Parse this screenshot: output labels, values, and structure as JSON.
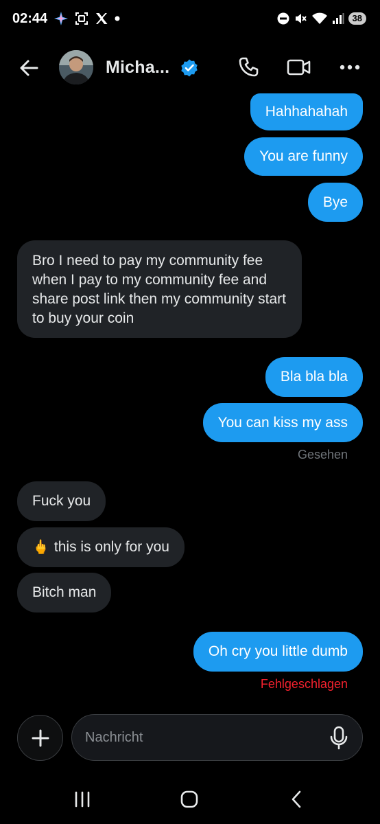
{
  "status_bar": {
    "time": "02:44",
    "battery": "38",
    "left_icons": [
      "sparkle-icon",
      "screenshot-icon",
      "x-logo-icon",
      "dot-icon"
    ],
    "right_icons": [
      "dnd-icon",
      "mute-icon",
      "wifi-icon",
      "signal-icon",
      "battery-icon"
    ]
  },
  "header": {
    "contact_name": "Micha...",
    "verified": true,
    "accent_color": "#1d9bf0"
  },
  "messages": [
    {
      "direction": "sent",
      "text": "Hahhahahah"
    },
    {
      "direction": "sent",
      "text": "You are funny"
    },
    {
      "direction": "sent",
      "text": "Bye"
    },
    {
      "direction": "received",
      "text": "Bro I need to pay my community fee when I pay to my community fee and share post link then my community start to buy your coin"
    },
    {
      "direction": "sent",
      "text": "Bla bla bla"
    },
    {
      "direction": "sent",
      "text": "You can kiss my ass",
      "status": "Gesehen"
    },
    {
      "direction": "received",
      "text": "Fuck you"
    },
    {
      "direction": "received",
      "emoji": "🖕",
      "text": "this is only for you"
    },
    {
      "direction": "received",
      "text": "Bitch man"
    },
    {
      "direction": "sent",
      "text": "Oh cry you little dumb",
      "status": "Fehlgeschlagen",
      "status_color": "#f4212e"
    }
  ],
  "compose": {
    "placeholder": "Nachricht",
    "value": ""
  },
  "colors": {
    "sent_bubble": "#1d9bf0",
    "received_bubble": "#202327",
    "background": "#000000"
  }
}
